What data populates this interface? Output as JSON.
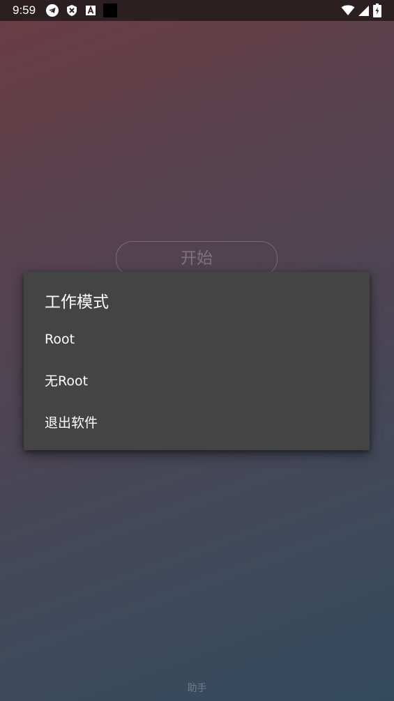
{
  "status_bar": {
    "time": "9:59",
    "left_icons": [
      "telegram-icon",
      "x-shield-icon",
      "a-badge-icon",
      "black-square-icon"
    ],
    "right_icons": [
      "wifi-icon",
      "cellular-signal-icon",
      "battery-charging-icon"
    ]
  },
  "main": {
    "start_button_label": "开始"
  },
  "dialog": {
    "title": "工作模式",
    "items": [
      {
        "label": "Root"
      },
      {
        "label": "无Root"
      },
      {
        "label": "退出软件"
      }
    ]
  },
  "footer": {
    "text": "助手"
  },
  "colors": {
    "dialog_background": "#444444",
    "status_bar": "#2b1f22",
    "gradient_top": "#6a3c45",
    "gradient_bottom": "#334a5e"
  }
}
